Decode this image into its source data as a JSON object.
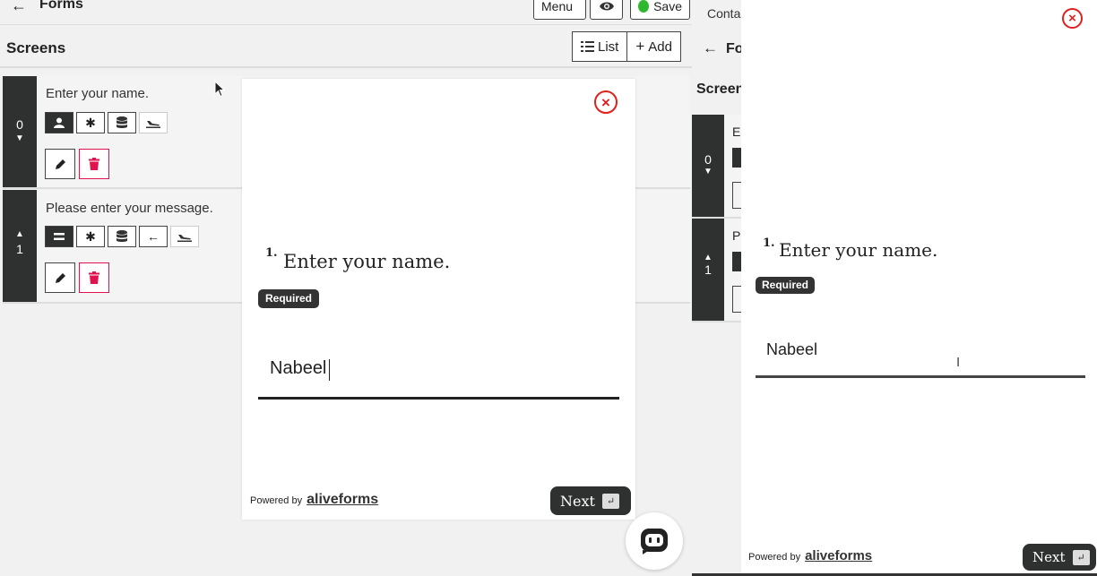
{
  "editor": {
    "back_icon": "arrow-left-icon",
    "title": "Forms",
    "toolbar": {
      "menu_label": "Menu",
      "preview_icon": "eye-icon",
      "save_label": "Save",
      "save_status_color": "#2db82d"
    },
    "screens_heading": "Screens",
    "list_label": "List",
    "add_label": "Add",
    "screens": [
      {
        "index": "0",
        "text": "Enter your name.",
        "icons": [
          "user-icon",
          "asterisk-icon",
          "database-icon",
          "plane-landing-icon"
        ]
      },
      {
        "index": "1",
        "text": "Please enter your message.",
        "icons": [
          "equals-icon",
          "asterisk-icon",
          "database-icon",
          "arrow-left-icon",
          "plane-landing-icon"
        ]
      }
    ]
  },
  "preview_modal": {
    "question_number": "1.",
    "question": "Enter your name.",
    "required_badge": "Required",
    "answer_value": "Nabeel",
    "powered_by": "Powered by",
    "brand": "aliveforms",
    "next_label": "Next",
    "enter_key": "↵"
  },
  "preview_pane": {
    "contact_fragment": "Conta",
    "forms_fragment": "Fo",
    "screens_fragment": "Screen",
    "item_fragments": [
      "Er",
      "P"
    ],
    "indices": [
      "0",
      "1"
    ],
    "question_number": "1.",
    "question": "Enter your name.",
    "required_badge": "Required",
    "answer_value": "Nabeel",
    "powered_by": "Powered by",
    "brand": "aliveforms",
    "next_label": "Next",
    "enter_key": "↵"
  },
  "colors": {
    "accent_dark": "#2f3030",
    "delete_red": "#e1134f",
    "close_red": "#e0201f"
  }
}
